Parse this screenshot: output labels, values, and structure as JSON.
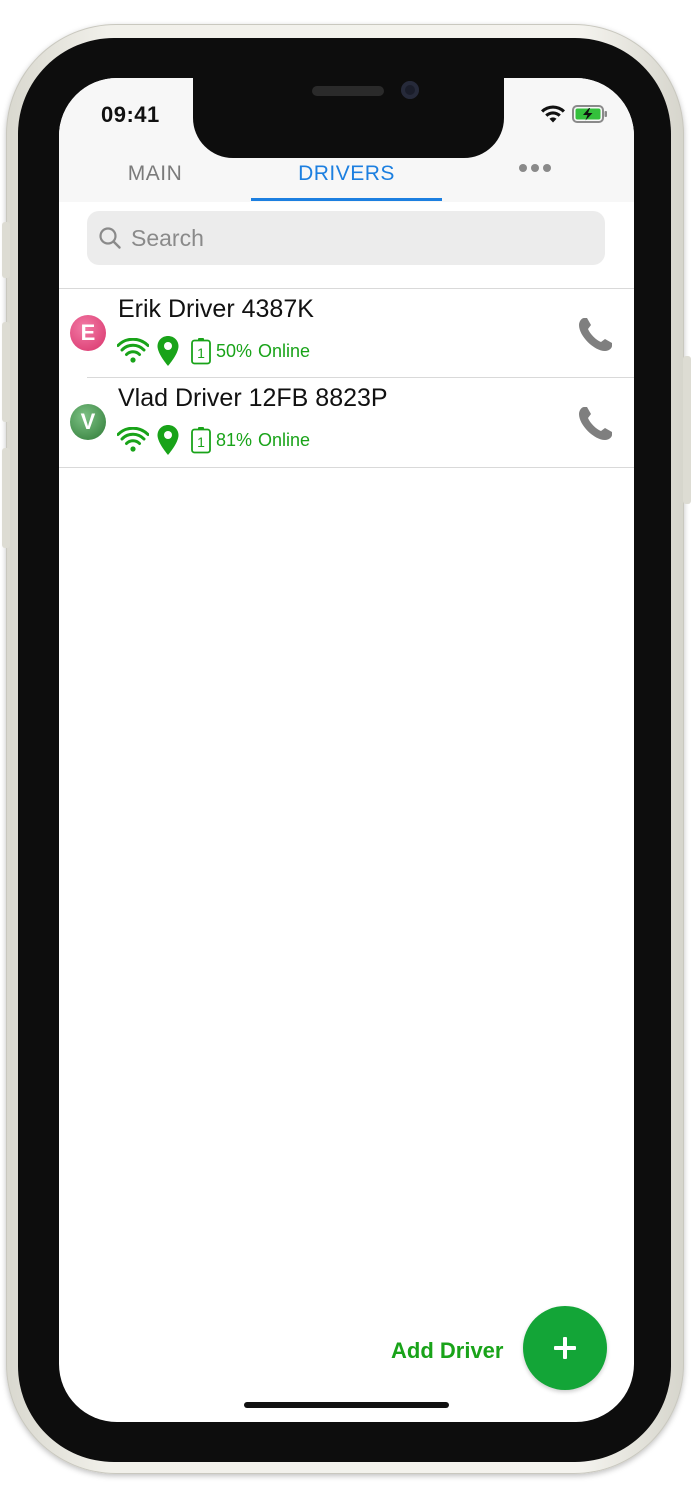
{
  "status_bar": {
    "time": "09:41",
    "icons": [
      "wifi-icon",
      "battery-charging-icon"
    ]
  },
  "tabs": [
    {
      "label": "MAIN",
      "active": false
    },
    {
      "label": "DRIVERS",
      "active": true
    },
    {
      "label": "more-menu",
      "icon": "more-dots-icon"
    }
  ],
  "search": {
    "placeholder": "Search"
  },
  "drivers": [
    {
      "initial": "E",
      "name": "Erik Driver 4387K",
      "avatar_color": "#e4457c",
      "battery_level": "1",
      "battery_pct": "50%",
      "status": "Online",
      "icons": [
        "wifi-icon",
        "location-pin-icon",
        "battery-icon",
        "phone-icon"
      ]
    },
    {
      "initial": "V",
      "name": "Vlad Driver 12FB 8823P",
      "avatar_color": "#3e8c46",
      "battery_level": "1",
      "battery_pct": "81%",
      "status": "Online",
      "icons": [
        "wifi-icon",
        "location-pin-icon",
        "battery-icon",
        "phone-icon"
      ]
    }
  ],
  "add_driver": {
    "label": "Add Driver",
    "fab_symbol": "+"
  },
  "colors": {
    "accent": "#1c7fe0",
    "online": "#19a319",
    "fab": "#13a537"
  }
}
